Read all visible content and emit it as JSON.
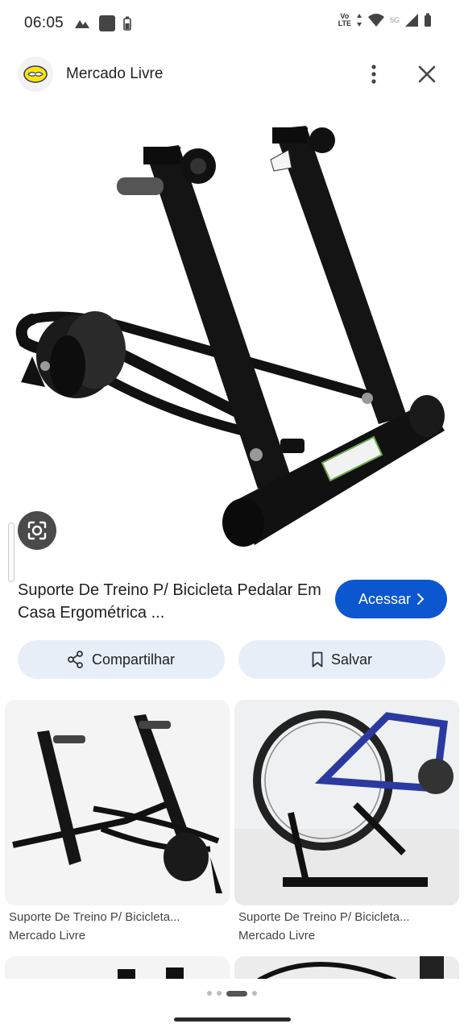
{
  "status_bar": {
    "time": "06:05",
    "network_label_top": "Vo",
    "network_label_bottom": "LTE",
    "network_5g": "5G"
  },
  "header": {
    "site_name": "Mercado Livre",
    "logo_icon": "mercado-livre-handshake-logo"
  },
  "product": {
    "title": "Suporte De Treino P/ Bicicleta Pedalar Em Casa Ergométrica ...",
    "visit_label": "Acessar",
    "share_label": "Compartilhar",
    "save_label": "Salvar"
  },
  "related": [
    {
      "title": "Suporte De Treino P/ Bicicleta...",
      "source": "Mercado Livre"
    },
    {
      "title": "Suporte De Treino P/ Bicicleta...",
      "source": "Mercado Livre"
    }
  ],
  "colors": {
    "accent": "#0b57d0",
    "chip_bg": "#e8eef8",
    "stand_black": "#111111"
  }
}
